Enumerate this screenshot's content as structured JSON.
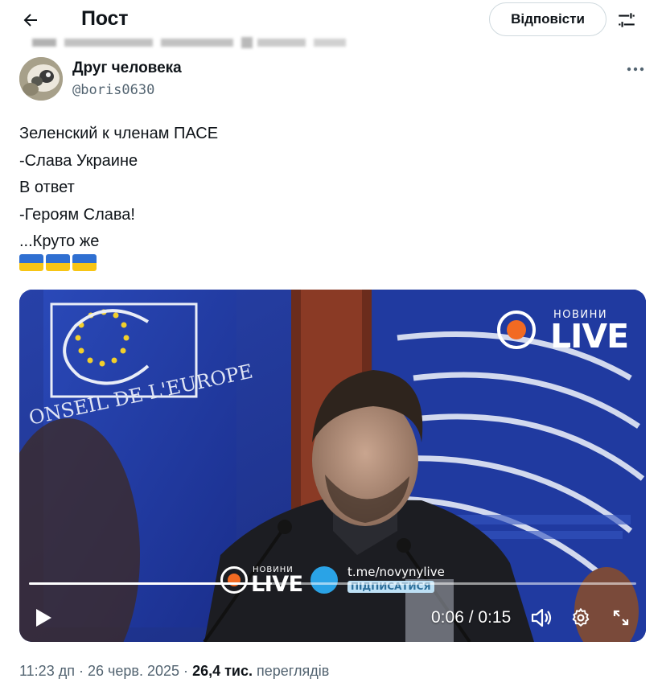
{
  "header": {
    "title": "Пост",
    "reply_label": "Відповісти",
    "back_icon": "arrow-left-icon",
    "filter_icon": "sliders-icon"
  },
  "post": {
    "author_name": "Друг человека",
    "author_handle": "@boris0630",
    "text_lines": [
      "Зеленский к членам ПАСЕ",
      "-Слава Украине",
      "В ответ",
      "-Героям Слава!",
      "...Круто же"
    ],
    "flags": [
      "🇺🇦",
      "🇺🇦",
      "🇺🇦"
    ]
  },
  "video": {
    "current_time": "0:06",
    "duration": "0:15",
    "time_display": "0:06 / 0:15",
    "progress": 0.4,
    "watermark_top_small": "НОВИНИ",
    "watermark_top_big": "LIVE",
    "watermark_bottom_small": "НОВИНИ",
    "watermark_bottom_big": "LIVE",
    "telegram_link": "t.me/novynylive",
    "subscribe_label": "ПІДПИСАТИСЯ",
    "background_text": "ONSEIL DE L'EUROPE"
  },
  "meta": {
    "time": "11:23 дп",
    "date": "26 черв. 2025",
    "separator": "·",
    "views_count": "26,4 тис.",
    "views_label": "переглядів"
  },
  "colors": {
    "text_primary": "#0f1419",
    "text_secondary": "#536471",
    "border": "#cfd9de",
    "brand_orange": "#f26a22",
    "eu_blue": "#1c2f8a"
  }
}
